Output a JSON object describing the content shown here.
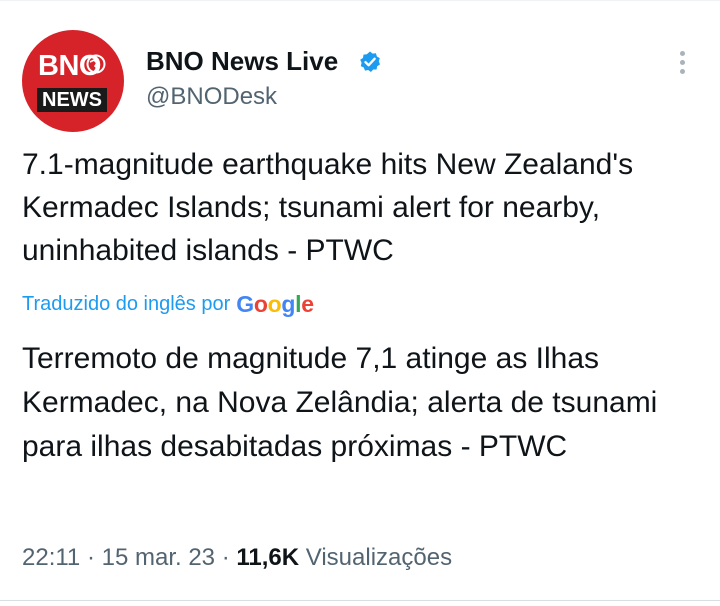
{
  "author": {
    "name": "BNO News Live",
    "handle": "@BNODesk",
    "avatar_text_top": "BNO",
    "avatar_text_bottom": "NEWS",
    "verified": true
  },
  "tweet": {
    "text": "7.1-magnitude earthquake hits New Zealand's Kermadec Islands; tsunami alert for nearby, uninhabited islands - PTWC",
    "translation_label": "Traduzido do inglês por",
    "translation_provider": "Google",
    "translated_text": "Terremoto de magnitude 7,1 atinge as Ilhas Kermadec, na Nova Zelândia; alerta de tsunami para ilhas desabitadas próximas - PTWC",
    "time": "22:11",
    "sep1": "·",
    "date": "15 mar. 23",
    "sep2": "·",
    "views_count": "11,6K",
    "views_label": "Visualizações"
  },
  "colors": {
    "link": "#1d9bf0",
    "secondary_text": "#536471",
    "avatar_red": "#d6232a",
    "verified_blue": "#1d9bf0"
  },
  "icons": {
    "verified": "verified-badge-icon",
    "more": "more-options-icon"
  }
}
